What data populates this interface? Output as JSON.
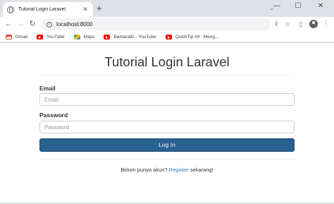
{
  "browser": {
    "tab": {
      "title": "Tutorial Login Laravel",
      "close": "✕"
    },
    "new_tab": "+",
    "tab_dropdown": "⌄",
    "window_controls": {
      "minimize": "—",
      "maximize": "☐",
      "close": "✕"
    },
    "nav": {
      "back": "←",
      "forward": "→",
      "reload": "↻"
    },
    "url": "localhost:8000",
    "toolbar_icons": {
      "share": "⇪",
      "bookmark": "☆",
      "sidepanel": "▯",
      "menu": "⋮"
    },
    "bookmarks": [
      {
        "label": "Gmail",
        "icon": "gmail-icon"
      },
      {
        "label": "YouTube",
        "icon": "youtube-icon"
      },
      {
        "label": "Maps",
        "icon": "maps-icon"
      },
      {
        "label": "BamaraID - YouTube",
        "icon": "youtube-icon"
      },
      {
        "label": "QuickTip #9 : Meng...",
        "icon": "youtube-icon"
      }
    ]
  },
  "page": {
    "heading": "Tutorial Login Laravel",
    "email_label": "Email",
    "email_placeholder": "Email",
    "password_label": "Password",
    "password_placeholder": "Password",
    "login_button": "Log In",
    "footer_prefix": "Belum punya akun? ",
    "footer_link": "Register",
    "footer_suffix": " sekarang!"
  },
  "colors": {
    "button_primary": "#286090",
    "link": "#337ab7"
  }
}
